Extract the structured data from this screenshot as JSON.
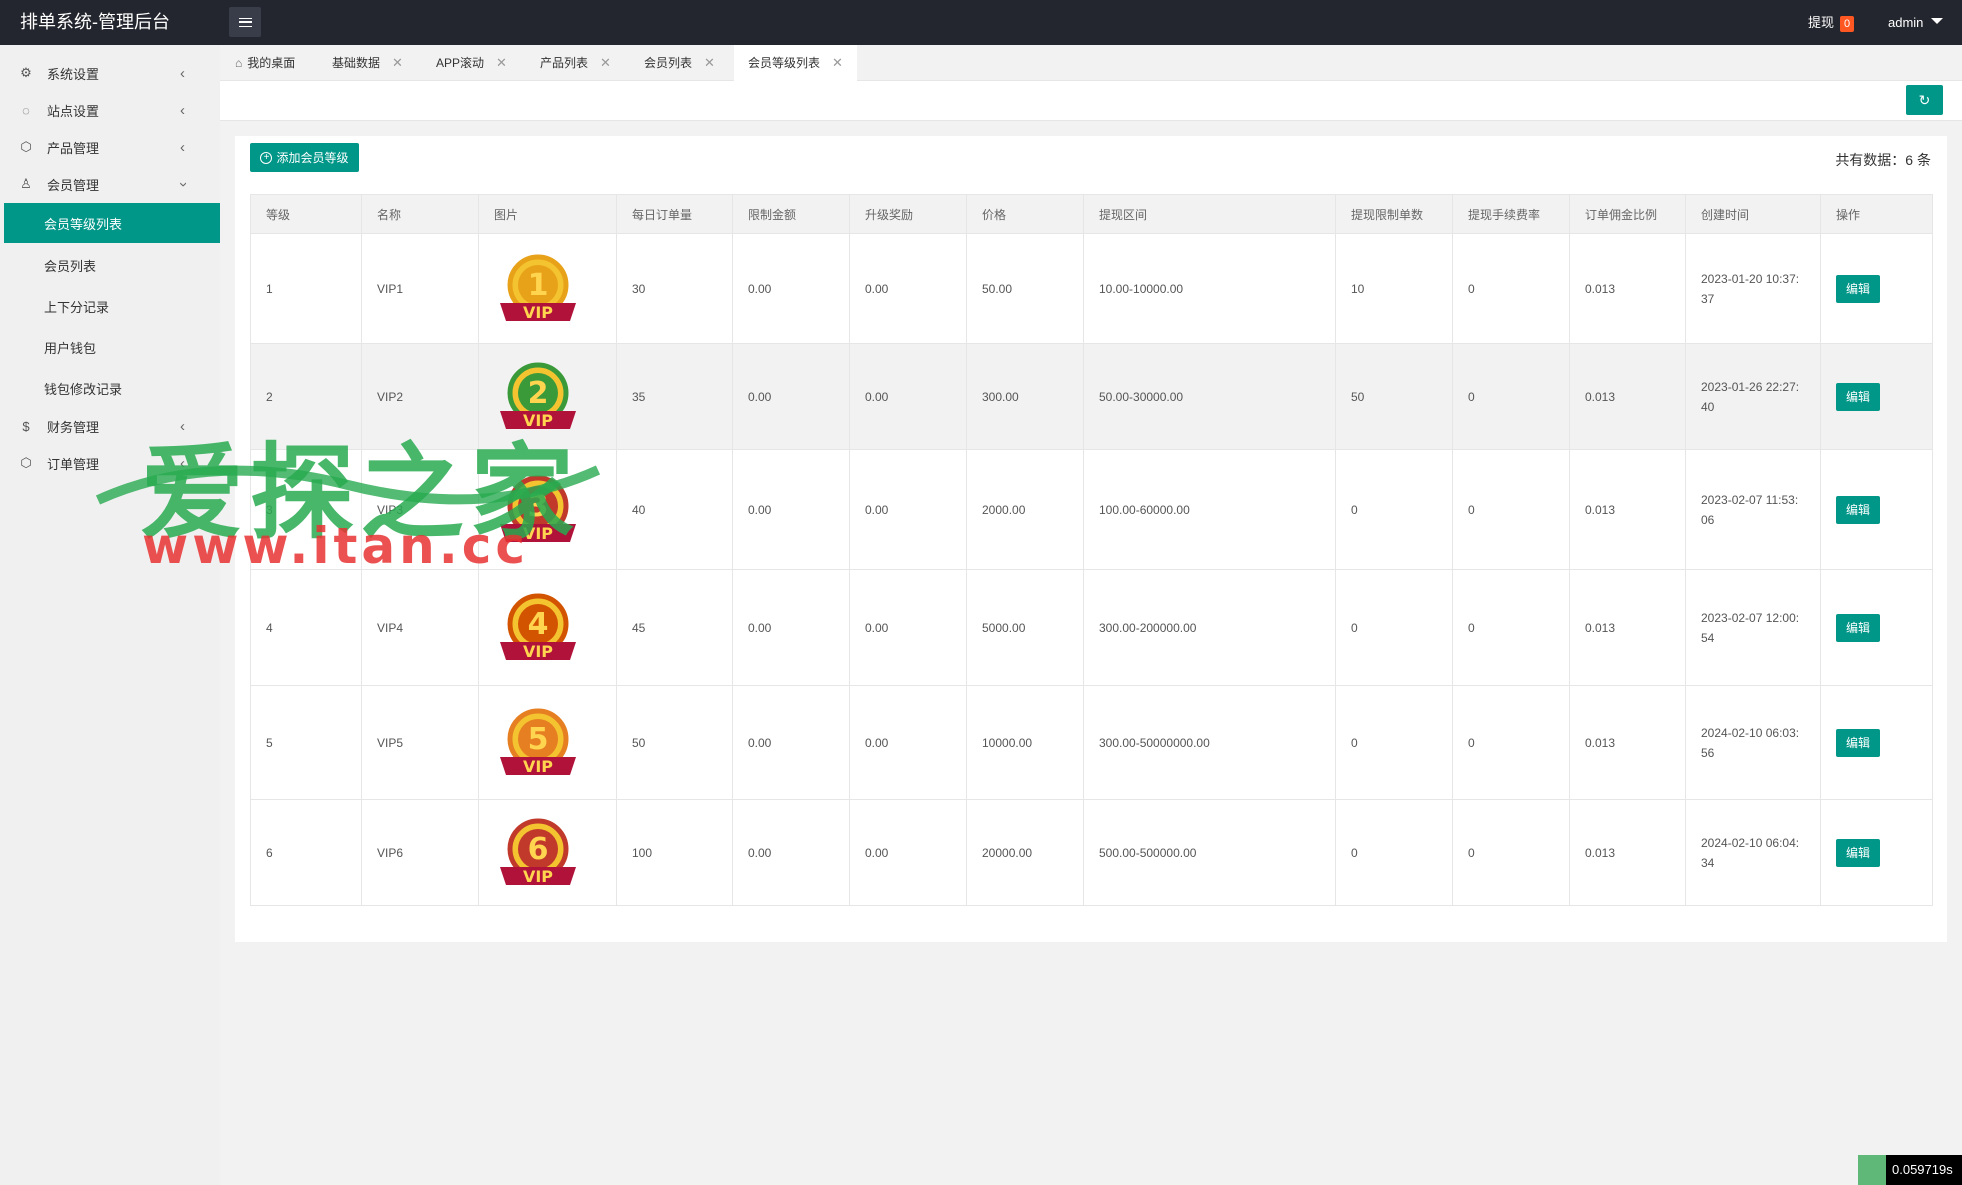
{
  "header": {
    "title": "排单系统-管理后台",
    "withdraw_label": "提现",
    "withdraw_count": "0",
    "user": "admin"
  },
  "sidebar": {
    "items": [
      {
        "label": "系统设置",
        "icon": "gear-icon"
      },
      {
        "label": "站点设置",
        "icon": "site-icon"
      },
      {
        "label": "产品管理",
        "icon": "box-icon"
      },
      {
        "label": "会员管理",
        "icon": "user-icon"
      },
      {
        "label": "财务管理",
        "icon": "dollar-icon"
      },
      {
        "label": "订单管理",
        "icon": "box-icon"
      }
    ],
    "sub_items": [
      "会员等级列表",
      "会员列表",
      "上下分记录",
      "用户钱包",
      "钱包修改记录"
    ]
  },
  "tabs": [
    "我的桌面",
    "基础数据",
    "APP滚动",
    "产品列表",
    "会员列表",
    "会员等级列表"
  ],
  "main": {
    "add_button": "添加会员等级",
    "total_label": "共有数据：6 条"
  },
  "table": {
    "headers": [
      "等级",
      "名称",
      "图片",
      "每日订单量",
      "限制金额",
      "升级奖励",
      "价格",
      "提现区间",
      "提现限制单数",
      "提现手续费率",
      "订单佣金比例",
      "创建时间",
      "操作"
    ],
    "edit_label": "编辑",
    "rows": [
      {
        "level": "1",
        "name": "VIP1",
        "badge_num": "1",
        "daily": "30",
        "limit": "0.00",
        "reward": "0.00",
        "price": "50.00",
        "range": "10.00-10000.00",
        "wd_limit": "10",
        "fee": "0",
        "commission": "0.013",
        "created_a": "2023-01-20 10:37:",
        "created_b": "37"
      },
      {
        "level": "2",
        "name": "VIP2",
        "badge_num": "2",
        "daily": "35",
        "limit": "0.00",
        "reward": "0.00",
        "price": "300.00",
        "range": "50.00-30000.00",
        "wd_limit": "50",
        "fee": "0",
        "commission": "0.013",
        "created_a": "2023-01-26 22:27:",
        "created_b": "40"
      },
      {
        "level": "3",
        "name": "VIP3",
        "badge_num": "3",
        "daily": "40",
        "limit": "0.00",
        "reward": "0.00",
        "price": "2000.00",
        "range": "100.00-60000.00",
        "wd_limit": "0",
        "fee": "0",
        "commission": "0.013",
        "created_a": "2023-02-07 11:53:",
        "created_b": "06"
      },
      {
        "level": "4",
        "name": "VIP4",
        "badge_num": "4",
        "daily": "45",
        "limit": "0.00",
        "reward": "0.00",
        "price": "5000.00",
        "range": "300.00-200000.00",
        "wd_limit": "0",
        "fee": "0",
        "commission": "0.013",
        "created_a": "2023-02-07 12:00:",
        "created_b": "54"
      },
      {
        "level": "5",
        "name": "VIP5",
        "badge_num": "5",
        "daily": "50",
        "limit": "0.00",
        "reward": "0.00",
        "price": "10000.00",
        "range": "300.00-50000000.00",
        "wd_limit": "0",
        "fee": "0",
        "commission": "0.013",
        "created_a": "2024-02-10 06:03:",
        "created_b": "56"
      },
      {
        "level": "6",
        "name": "VIP6",
        "badge_num": "6",
        "daily": "100",
        "limit": "0.00",
        "reward": "0.00",
        "price": "20000.00",
        "range": "500.00-500000.00",
        "wd_limit": "0",
        "fee": "0",
        "commission": "0.013",
        "created_a": "2024-02-10 06:04:",
        "created_b": "34"
      }
    ]
  },
  "watermark": {
    "text_cn": "爱探之家",
    "text_url": "www.itan.cc"
  },
  "timer": "0.059719s",
  "colors": {
    "accent": "#009688",
    "header_bg": "#23262e",
    "badge": "#ff5722"
  }
}
